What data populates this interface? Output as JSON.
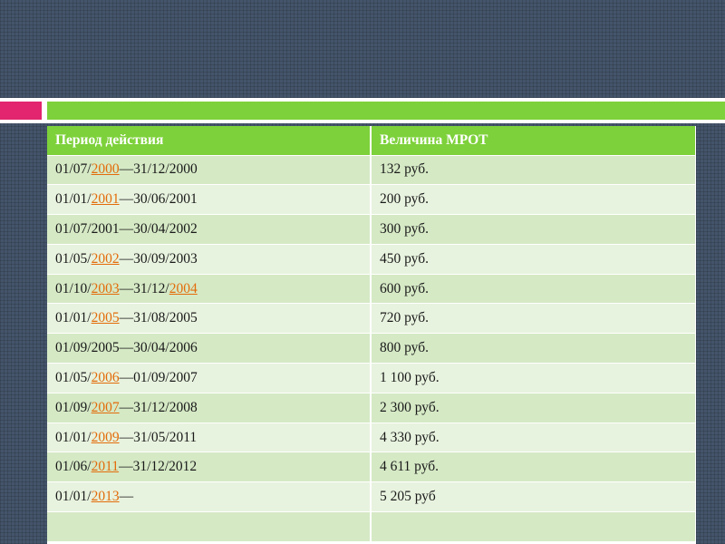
{
  "table": {
    "headers": [
      "Период  действия",
      "Величина МРОТ"
    ],
    "rows": [
      {
        "period": [
          {
            "t": "01/07/"
          },
          {
            "t": "2000",
            "link": true
          },
          {
            "t": "—31/12/2000"
          }
        ],
        "amount": "132 руб."
      },
      {
        "period": [
          {
            "t": "01/01/"
          },
          {
            "t": "2001",
            "link": true
          },
          {
            "t": "—30/06/2001"
          }
        ],
        "amount": "200 руб."
      },
      {
        "period": [
          {
            "t": "01/07/2001—30/04/2002"
          }
        ],
        "amount": "300 руб."
      },
      {
        "period": [
          {
            "t": "01/05/"
          },
          {
            "t": "2002",
            "link": true
          },
          {
            "t": "—30/09/2003"
          }
        ],
        "amount": "450 руб."
      },
      {
        "period": [
          {
            "t": "01/10/"
          },
          {
            "t": "2003",
            "link": true
          },
          {
            "t": "—31/12/"
          },
          {
            "t": "2004",
            "link": true
          }
        ],
        "amount": "600 руб."
      },
      {
        "period": [
          {
            "t": "01/01/"
          },
          {
            "t": "2005",
            "link": true
          },
          {
            "t": "—31/08/2005"
          }
        ],
        "amount": "720 руб."
      },
      {
        "period": [
          {
            "t": "01/09/2005—30/04/2006"
          }
        ],
        "amount": "800 руб."
      },
      {
        "period": [
          {
            "t": "01/05/"
          },
          {
            "t": "2006",
            "link": true
          },
          {
            "t": "—01/09/2007"
          }
        ],
        "amount": "1 100 руб."
      },
      {
        "period": [
          {
            "t": "01/09/"
          },
          {
            "t": "2007",
            "link": true
          },
          {
            "t": "—31/12/2008"
          }
        ],
        "amount": "2 300 руб."
      },
      {
        "period": [
          {
            "t": "01/01/"
          },
          {
            "t": "2009",
            "link": true
          },
          {
            "t": "—31/05/2011"
          }
        ],
        "amount": "4 330 руб."
      },
      {
        "period": [
          {
            "t": "01/06/"
          },
          {
            "t": "2011",
            "link": true
          },
          {
            "t": "—31/12/2012"
          }
        ],
        "amount": "4 611 руб."
      },
      {
        "period": [
          {
            "t": "01/01/"
          },
          {
            "t": "2013",
            "link": true
          },
          {
            "t": "—"
          }
        ],
        "amount": "5 205 руб"
      },
      {
        "period": [],
        "amount": ""
      }
    ]
  },
  "colors": {
    "background": "#44546a",
    "accent_green": "#7dd13a",
    "accent_pink": "#e2256e",
    "row_dark": "#d5e9c5",
    "row_light": "#e8f3df",
    "link": "#e36c0a"
  }
}
